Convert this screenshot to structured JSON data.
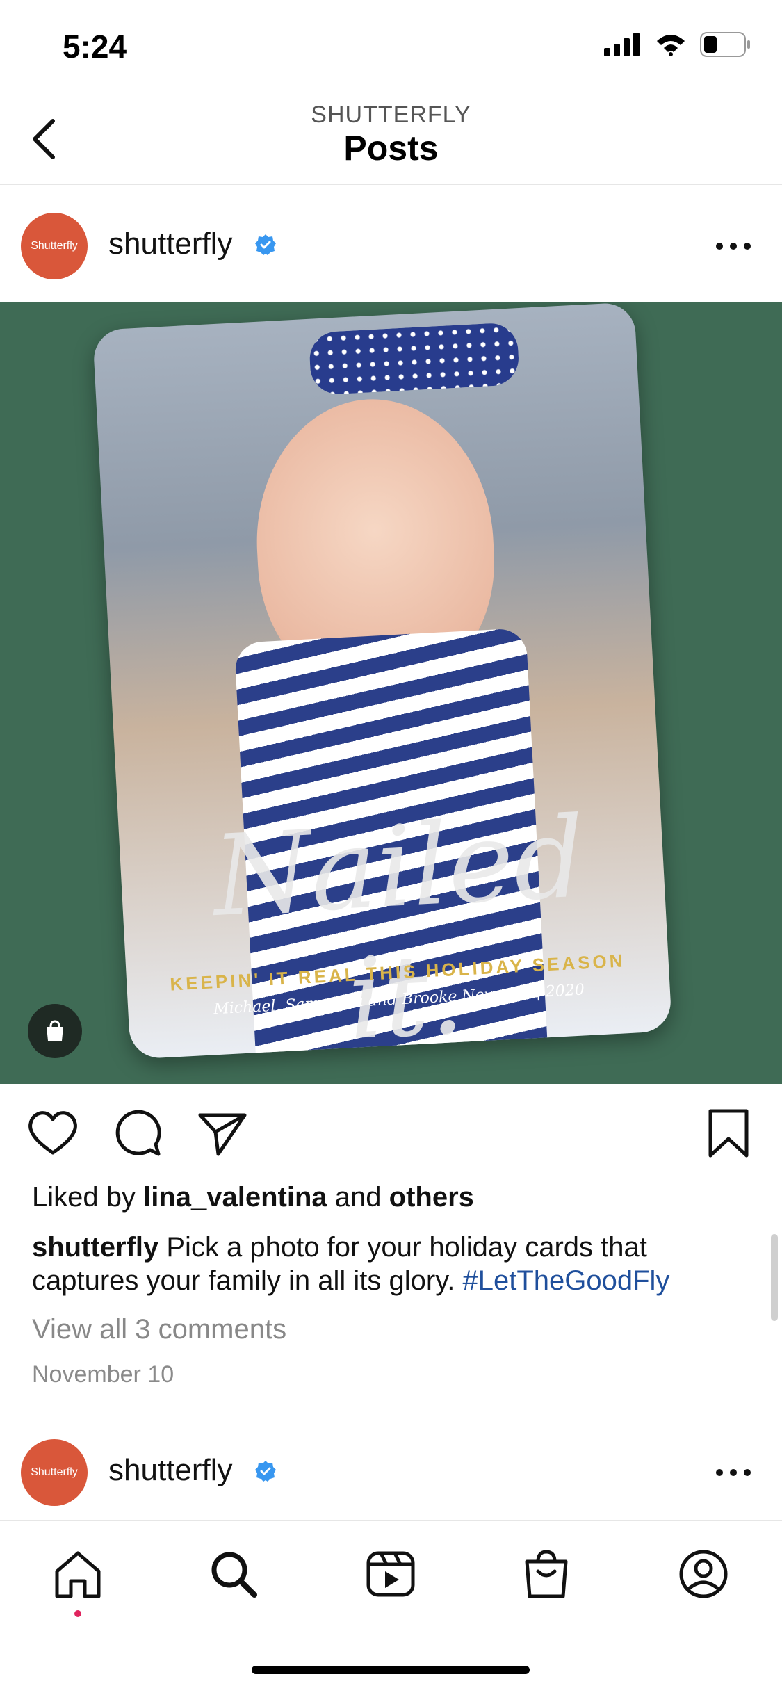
{
  "status_bar": {
    "time": "5:24",
    "battery_level": 0.28
  },
  "header": {
    "subtitle": "SHUTTERFLY",
    "title": "Posts"
  },
  "posts": [
    {
      "avatar_text": "Shutterfly",
      "username": "shutterfly",
      "verified": true,
      "image": {
        "script_text": "Nailed it.",
        "tagline": "KEEPIN' IT REAL THIS HOLIDAY SEASON",
        "names_line": "Michael, Samantha and Brooke Newman | 2020"
      },
      "liked_by_prefix": "Liked by",
      "liked_by_user": "lina_valentina",
      "liked_by_and": "and",
      "liked_by_others": "others",
      "caption_user": "shutterfly",
      "caption_text": "Pick a photo for your holiday cards that captures your family in all its glory.",
      "hashtag": "#LetTheGoodFly",
      "comments_link": "View all 3 comments",
      "date": "November 10"
    },
    {
      "avatar_text": "Shutterfly",
      "username": "shutterfly",
      "verified": true
    }
  ],
  "colors": {
    "brand_orange": "#d9573a",
    "verified_blue": "#3897f0",
    "hashtag_blue": "#1f4f9c",
    "photo_bg": "#3f6b55",
    "notification_dot": "#e0245e"
  },
  "icons": {
    "actions": [
      "heart-icon",
      "comment-icon",
      "share-icon",
      "bookmark-icon"
    ],
    "tabs": [
      "home-icon",
      "search-icon",
      "reels-icon",
      "shop-icon",
      "profile-icon"
    ]
  }
}
